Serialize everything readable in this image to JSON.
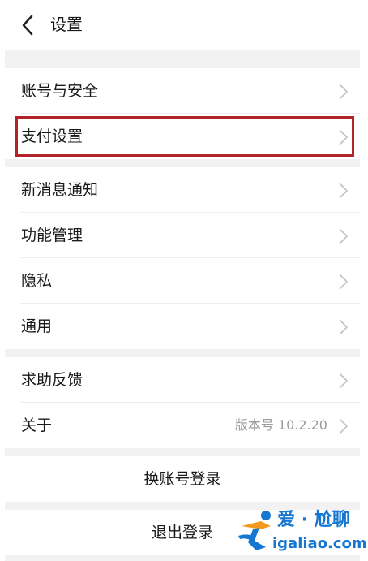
{
  "header": {
    "back_icon": "chevron-left-icon",
    "title": "设置"
  },
  "sections": {
    "account": {
      "items": [
        {
          "label": "账号与安全"
        },
        {
          "label": "支付设置"
        }
      ]
    },
    "notify": {
      "items": [
        {
          "label": "新消息通知"
        },
        {
          "label": "功能管理"
        },
        {
          "label": "隐私"
        },
        {
          "label": "通用"
        }
      ]
    },
    "help": {
      "items": [
        {
          "label": "求助反馈"
        },
        {
          "label": "关于",
          "value": "版本号 10.2.20"
        }
      ]
    }
  },
  "actions": {
    "switch_account": "换账号登录",
    "logout": "退出登录"
  },
  "watermark": {
    "brand": "爱 · 尬聊",
    "domain": "igaliao.com"
  },
  "colors": {
    "highlight_border": "#b3232a",
    "gap_background": "#f2f2f2",
    "watermark_blue": "#1677d2",
    "watermark_orange": "#f39a1e"
  }
}
